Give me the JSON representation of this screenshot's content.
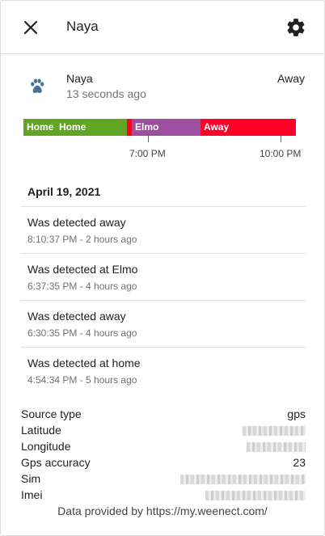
{
  "header": {
    "title": "Naya",
    "close_icon": "close-icon",
    "settings_icon": "gear-icon"
  },
  "entity": {
    "icon": "paw-icon",
    "name": "Naya",
    "last_changed": "13 seconds ago",
    "state": "Away"
  },
  "timeline": {
    "segments": [
      {
        "label": "Home",
        "color": "#62a524"
      },
      {
        "label": "Home",
        "color": "#62a524"
      },
      {
        "label": "",
        "color": "#ff0029"
      },
      {
        "label": "Elmo",
        "color": "#9c4f9f"
      },
      {
        "label": "Away",
        "color": "#ff0029"
      }
    ],
    "ticks": [
      "7:00 PM",
      "10:00 PM"
    ]
  },
  "logbook": {
    "date": "April 19, 2021",
    "entries": [
      {
        "message": "Was detected away",
        "time": "8:10:37 PM - 2 hours ago"
      },
      {
        "message": "Was detected at Elmo",
        "time": "6:37:35 PM - 4 hours ago"
      },
      {
        "message": "Was detected away",
        "time": "6:30:35 PM - 4 hours ago"
      },
      {
        "message": "Was detected at home",
        "time": "4:54:34 PM - 5 hours ago"
      }
    ]
  },
  "attributes": [
    {
      "key": "Source type",
      "value": "gps"
    },
    {
      "key": "Latitude",
      "value": ""
    },
    {
      "key": "Longitude",
      "value": ""
    },
    {
      "key": "Gps accuracy",
      "value": "23"
    },
    {
      "key": "Sim",
      "value": ""
    },
    {
      "key": "Imei",
      "value": ""
    }
  ],
  "footer": {
    "attribution": "Data provided by https://my.weenect.com/"
  }
}
